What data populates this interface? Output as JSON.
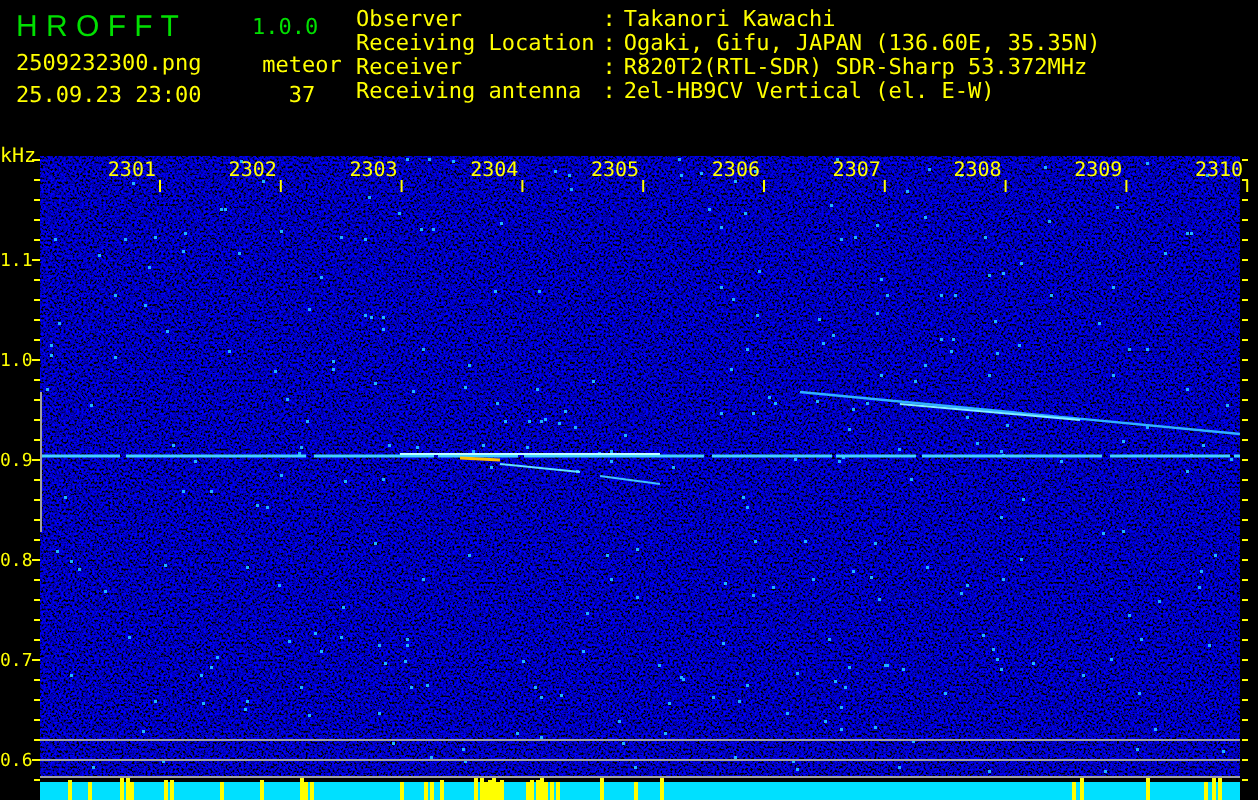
{
  "app": {
    "name": "H R O F F T",
    "version": "1.0.0"
  },
  "file_name": "2509232300.png",
  "timestamp": "25.09.23 23:00",
  "meteor_count": {
    "label": "meteor",
    "value": "37"
  },
  "station_info": [
    {
      "label": "Observer",
      "separator": ":",
      "value": "Takanori Kawachi"
    },
    {
      "label": "Receiving Location",
      "separator": ":",
      "value": "Ogaki, Gifu, JAPAN (136.60E, 35.35N)"
    },
    {
      "label": "Receiver",
      "separator": ":",
      "value": "R820T2(RTL-SDR) SDR-Sharp 53.372MHz"
    },
    {
      "label": "Receiving antenna",
      "separator": ":",
      "value": "2el-HB9CV Vertical (el. E-W)"
    }
  ],
  "frequency_axis": {
    "unit": "kHz",
    "labels": [
      "1.1",
      "1.0",
      "0.9",
      "0.8",
      "0.7",
      "0.6"
    ]
  },
  "time_axis": {
    "labels": [
      "2301",
      "2302",
      "2303",
      "2304",
      "2305",
      "2306",
      "2307",
      "2308",
      "2309",
      "2310"
    ]
  }
}
